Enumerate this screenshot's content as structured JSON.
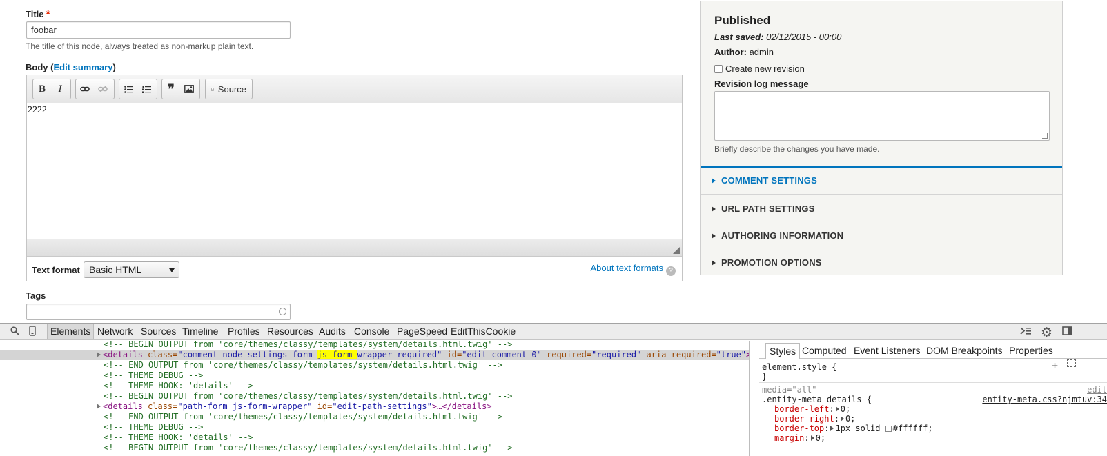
{
  "form": {
    "title_label": "Title",
    "title_required_mark": "*",
    "title_value": "foobar",
    "title_description": "The title of this node, always treated as non-markup plain text.",
    "body_label_prefix": "Body (",
    "body_edit_summary": "Edit summary",
    "body_label_suffix": ")",
    "editor": {
      "toolbar": {
        "bold": "B",
        "italic": "I",
        "link_icon": "link-icon",
        "unlink_icon": "unlink-icon",
        "bullet_list_icon": "bulleted-list-icon",
        "numbered_list_icon": "numbered-list-icon",
        "blockquote": "❞",
        "image_icon": "image-icon",
        "source_label": "Source"
      },
      "content": "2222",
      "text_format_label": "Text format",
      "text_format_value": "Basic HTML",
      "about_text_formats": "About text formats",
      "help_glyph": "?"
    },
    "tags_label": "Tags",
    "tags_value": ""
  },
  "sidebar": {
    "status": "Published",
    "last_saved_label": "Last saved:",
    "last_saved_value": "02/12/2015 - 00:00",
    "author_label": "Author:",
    "author_value": "admin",
    "create_revision_label": "Create new revision",
    "revision_log_label": "Revision log message",
    "revision_log_value": "",
    "revision_log_description": "Briefly describe the changes you have made.",
    "sections": [
      {
        "label": "COMMENT SETTINGS",
        "active": true
      },
      {
        "label": "URL PATH SETTINGS",
        "active": false
      },
      {
        "label": "AUTHORING INFORMATION",
        "active": false
      },
      {
        "label": "PROMOTION OPTIONS",
        "active": false
      }
    ],
    "accent_color": "#0074bd"
  },
  "devtools": {
    "tabs": [
      "Elements",
      "Network",
      "Sources",
      "Timeline",
      "Profiles",
      "Resources",
      "Audits",
      "Console",
      "PageSpeed",
      "EditThisCookie"
    ],
    "active_tab": "Elements",
    "dom_lines": {
      "l1": "<!-- BEGIN OUTPUT from 'core/themes/classy/templates/system/details.html.twig' -->",
      "l2_tag_open": "<details",
      "l2_class_attr": " class=",
      "l2_class_val_a": "\"comment-node-settings-form ",
      "l2_class_val_hl": "js-form-",
      "l2_class_val_b": "wrapper required\"",
      "l2_id_attr": " id=",
      "l2_id_val": "\"edit-comment-0\"",
      "l2_req_attr": " required=",
      "l2_req_val": "\"required\"",
      "l2_aria_attr": " aria-required=",
      "l2_aria_val": "\"true\"",
      "l2_end": ">…",
      "l3": "<!-- END OUTPUT from 'core/themes/classy/templates/system/details.html.twig' -->",
      "l4": "<!-- THEME DEBUG -->",
      "l5": "<!-- THEME HOOK: 'details' -->",
      "l6": "<!-- BEGIN OUTPUT from 'core/themes/classy/templates/system/details.html.twig' -->",
      "l7_tag_open": "<details",
      "l7_class_attr": " class=",
      "l7_class_val": "\"path-form js-form-wrapper\"",
      "l7_id_attr": " id=",
      "l7_id_val": "\"edit-path-settings\"",
      "l7_end": ">…</details>",
      "l8": "<!-- END OUTPUT from 'core/themes/classy/templates/system/details.html.twig' -->",
      "l9": "<!-- THEME DEBUG -->",
      "l10": "<!-- THEME HOOK: 'details' -->",
      "l11": "<!-- BEGIN OUTPUT from 'core/themes/classy/templates/system/details.html.twig' -->"
    },
    "styles_tabs": [
      "Styles",
      "Computed",
      "Event Listeners",
      "DOM Breakpoints",
      "Properties"
    ],
    "styles": {
      "element_style": "element.style {",
      "close_brace": "}",
      "media": "media=\"all\"",
      "edit_link": "edit",
      "selector": ".entity-meta details {",
      "source_link": "entity-meta.css?njmtuv:34",
      "props": [
        {
          "name": "border-left",
          "value": "0;"
        },
        {
          "name": "border-right",
          "value": "0;"
        },
        {
          "name": "border-top",
          "value": "1px solid",
          "color": "#ffffff;"
        },
        {
          "name": "margin",
          "value": "0;"
        }
      ]
    }
  }
}
